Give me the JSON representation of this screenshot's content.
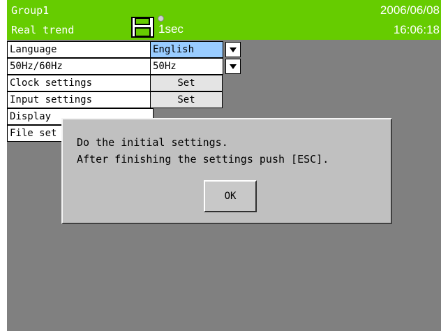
{
  "header": {
    "group": "Group1",
    "mode": "Real trend",
    "sampling_rate": "1sec",
    "date": "2006/06/08",
    "time": "16:06:18",
    "icons": [
      "floppy-disk-icon",
      "record-indicator-icon"
    ],
    "colors": {
      "background": "#66cc00",
      "text": "#ffffff"
    }
  },
  "settings": {
    "rows": [
      {
        "label": "Language",
        "value": "English"
      },
      {
        "label": "50Hz/60Hz",
        "value": "50Hz"
      },
      {
        "label": "Clock settings",
        "button": "Set"
      },
      {
        "label": "Input settings",
        "button": "Set"
      },
      {
        "label": "Display"
      },
      {
        "label": "File set"
      }
    ]
  },
  "dialog": {
    "line1": "Do the initial settings.",
    "line2": "After finishing the settings push [ESC].",
    "ok_label": "OK"
  },
  "colors": {
    "screen_background": "#808080",
    "selected_value": "#99ccff"
  }
}
